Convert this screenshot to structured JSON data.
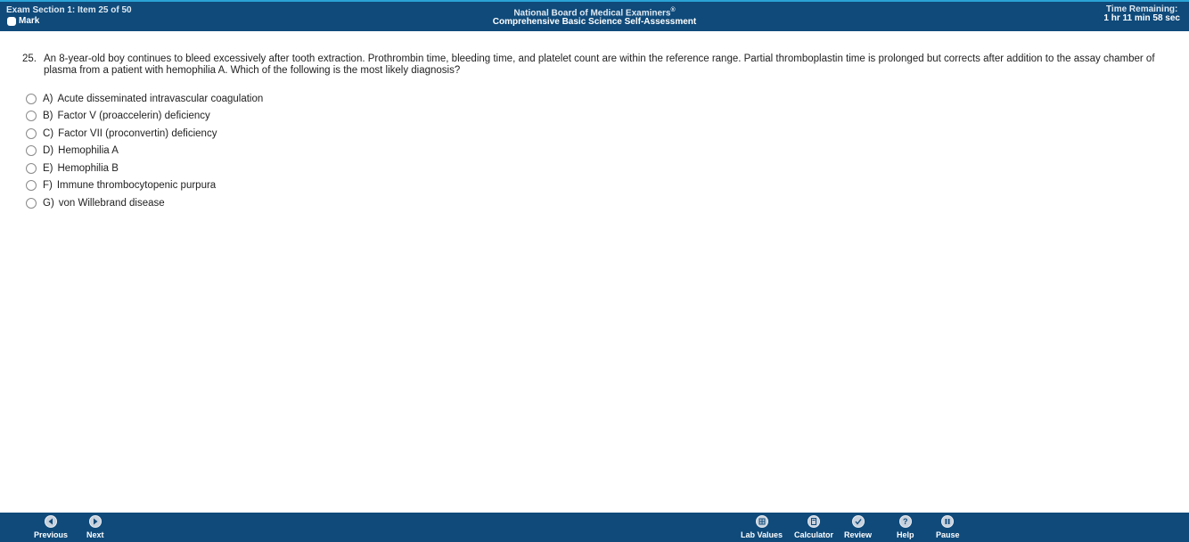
{
  "header": {
    "item_info": "Exam Section 1: Item 25 of 50",
    "mark_label": "Mark",
    "org_name": "National Board of Medical Examiners",
    "registered_mark": "®",
    "exam_title": "Comprehensive Basic Science Self-Assessment",
    "time_label": "Time Remaining:",
    "time_value": "1 hr 11 min 58 sec"
  },
  "question": {
    "number": "25.",
    "text": "An 8-year-old boy continues to bleed excessively after tooth extraction. Prothrombin time, bleeding time, and platelet count are within the reference range. Partial thromboplastin time is prolonged but corrects after addition to the assay chamber of plasma from a patient with hemophilia A. Which of the following is the most likely diagnosis?",
    "options": [
      {
        "letter": "A)",
        "text": "Acute disseminated intravascular coagulation"
      },
      {
        "letter": "B)",
        "text": "Factor V (proaccelerin) deficiency"
      },
      {
        "letter": "C)",
        "text": "Factor VII (proconvertin) deficiency"
      },
      {
        "letter": "D)",
        "text": "Hemophilia A"
      },
      {
        "letter": "E)",
        "text": "Hemophilia B"
      },
      {
        "letter": "F)",
        "text": "Immune thrombocytopenic purpura"
      },
      {
        "letter": "G)",
        "text": "von Willebrand disease"
      }
    ]
  },
  "footer": {
    "previous_label": "Previous",
    "next_label": "Next",
    "lab_values_label": "Lab Values",
    "calculator_label": "Calculator",
    "review_label": "Review",
    "help_label": "Help",
    "help_glyph": "?",
    "pause_label": "Pause"
  },
  "colors": {
    "bar": "#0f4a7a",
    "accent_line": "#2aa3d6"
  }
}
